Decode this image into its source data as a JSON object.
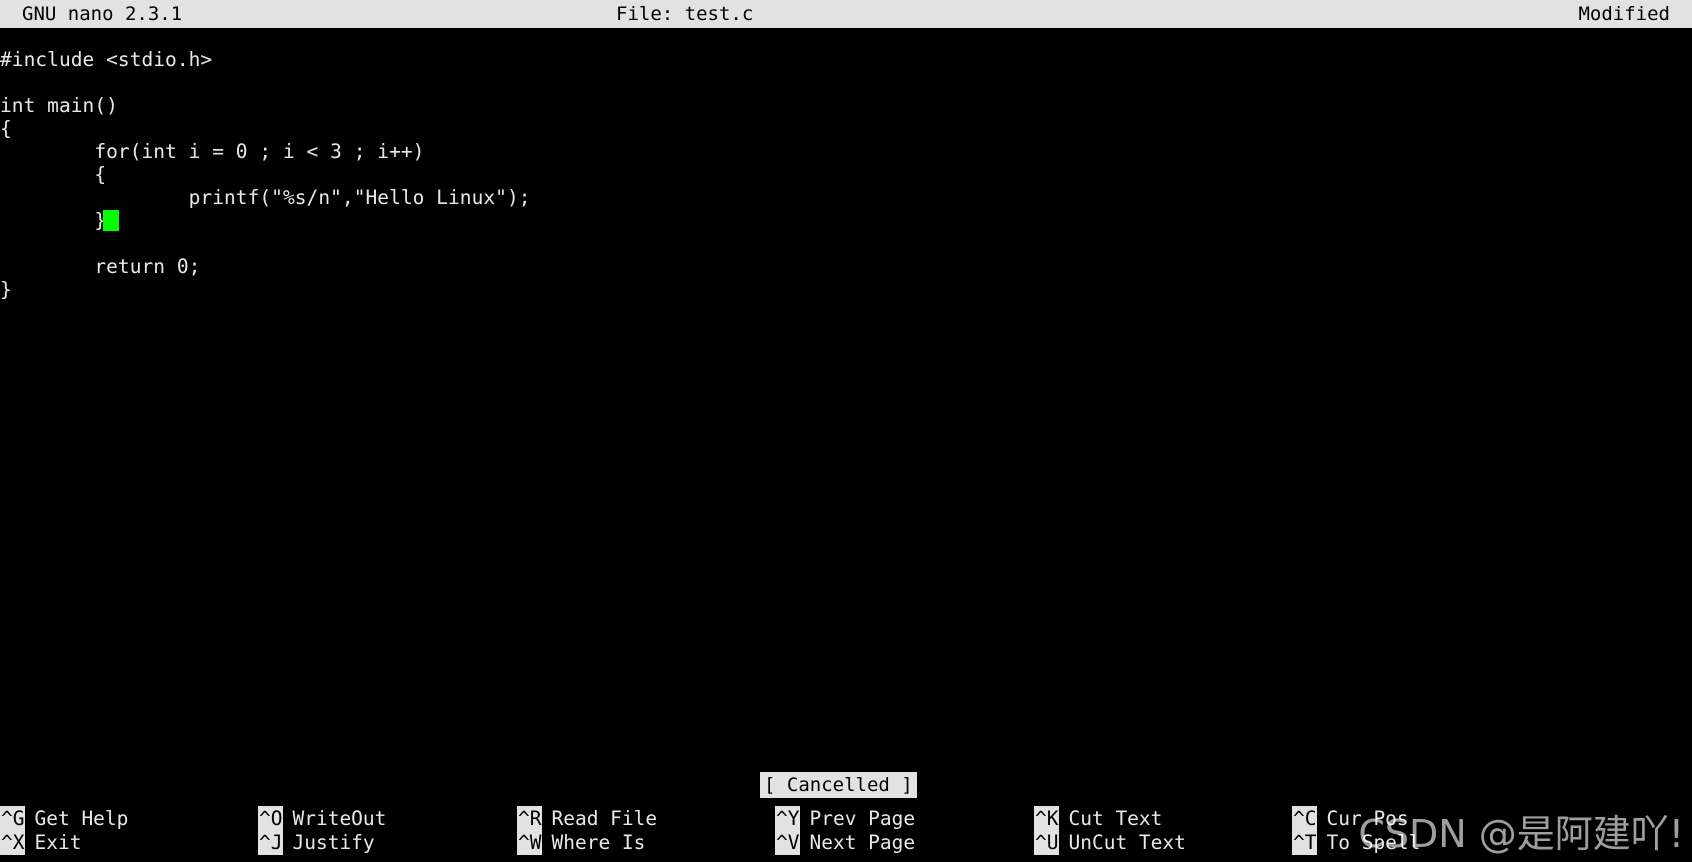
{
  "title_bar": {
    "app": "GNU nano 2.3.1",
    "file": "File: test.c",
    "modified": "Modified"
  },
  "editor": {
    "lines": [
      "#include <stdio.h>",
      "",
      "int main()",
      "{",
      "        for(int i = 0 ; i < 3 ; i++)",
      "        {",
      "                printf(\"%s/n\",\"Hello Linux\");",
      "        }",
      "",
      "        return 0;",
      "}"
    ],
    "cursor": {
      "line": 7,
      "column": 9
    }
  },
  "status_message": "[ Cancelled ]",
  "shortcut_bar": {
    "columns": [
      {
        "row1": {
          "key": "^G",
          "label": "Get Help"
        },
        "row2": {
          "key": "^X",
          "label": "Exit"
        }
      },
      {
        "row1": {
          "key": "^O",
          "label": "WriteOut"
        },
        "row2": {
          "key": "^J",
          "label": "Justify"
        }
      },
      {
        "row1": {
          "key": "^R",
          "label": "Read File"
        },
        "row2": {
          "key": "^W",
          "label": "Where Is"
        }
      },
      {
        "row1": {
          "key": "^Y",
          "label": "Prev Page"
        },
        "row2": {
          "key": "^V",
          "label": "Next Page"
        }
      },
      {
        "row1": {
          "key": "^K",
          "label": "Cut Text"
        },
        "row2": {
          "key": "^U",
          "label": "UnCut Text"
        }
      },
      {
        "row1": {
          "key": "^C",
          "label": "Cur Pos"
        },
        "row2": {
          "key": "^T",
          "label": "To Spell"
        }
      }
    ]
  },
  "watermark": "CSDN @是阿建吖!",
  "colors": {
    "background": "#000000",
    "foreground": "#e8e8e8",
    "inverted_bg": "#e2e2e2",
    "inverted_fg": "#000000",
    "cursor": "#00ff00"
  }
}
